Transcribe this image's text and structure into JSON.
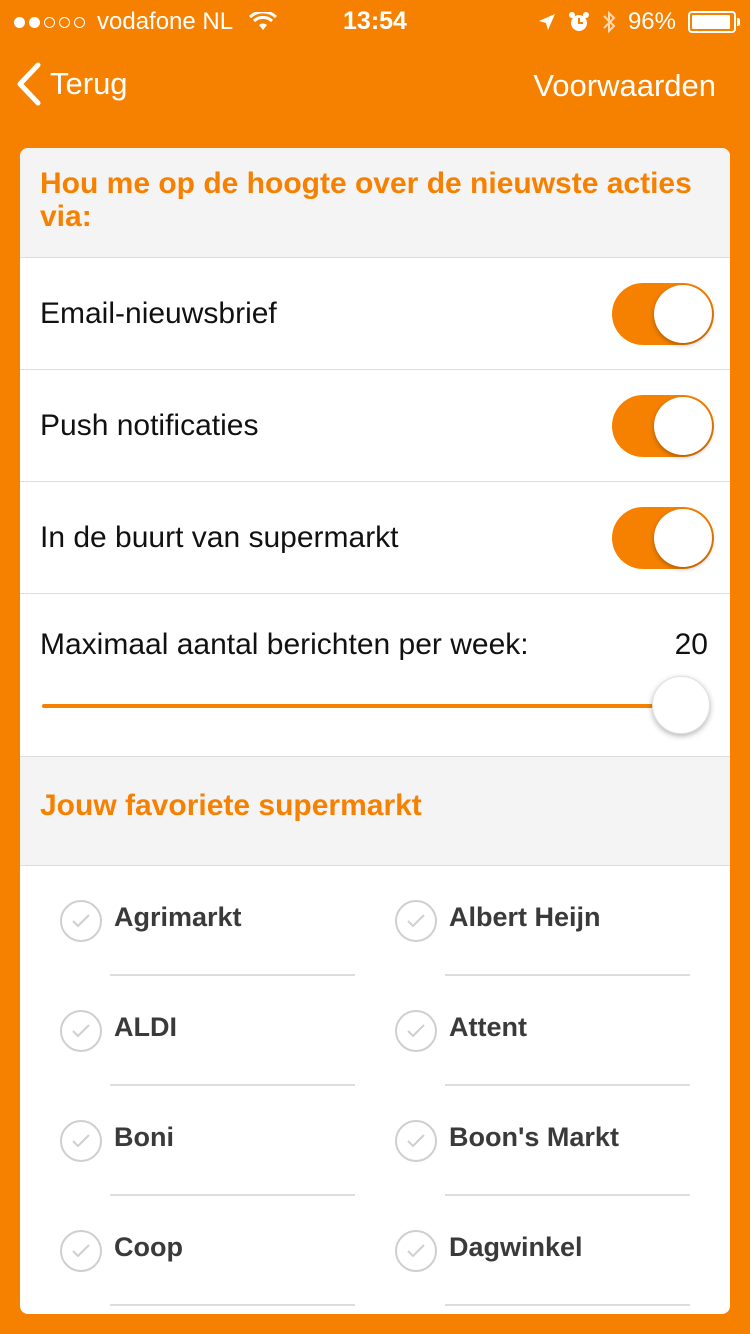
{
  "status_bar": {
    "carrier": "vodafone NL",
    "time": "13:54",
    "battery": "96%",
    "signal_bars_filled": 2,
    "signal_bars_total": 5,
    "battery_level": 0.96
  },
  "nav": {
    "back_label": "Terug",
    "right_label": "Voorwaarden"
  },
  "notifications": {
    "header": "Hou me op de hoogte over de nieuwste acties via:",
    "toggles": [
      {
        "label": "Email-nieuwsbrief",
        "on": true
      },
      {
        "label": "Push notificaties",
        "on": true
      },
      {
        "label": "In de buurt van supermarkt",
        "on": true
      }
    ],
    "max_messages": {
      "label": "Maximaal aantal berichten per week:",
      "value": "20"
    }
  },
  "favorites": {
    "header": "Jouw favoriete supermarkt",
    "stores": [
      "Agrimarkt",
      "Albert Heijn",
      "ALDI",
      "Attent",
      "Boni",
      "Boon's Markt",
      "Coop",
      "Dagwinkel"
    ]
  },
  "colors": {
    "accent": "#F68100",
    "header_bg": "#F4F4F4",
    "divider": "#DDDDDD",
    "check_gray": "#CFCFCF"
  }
}
